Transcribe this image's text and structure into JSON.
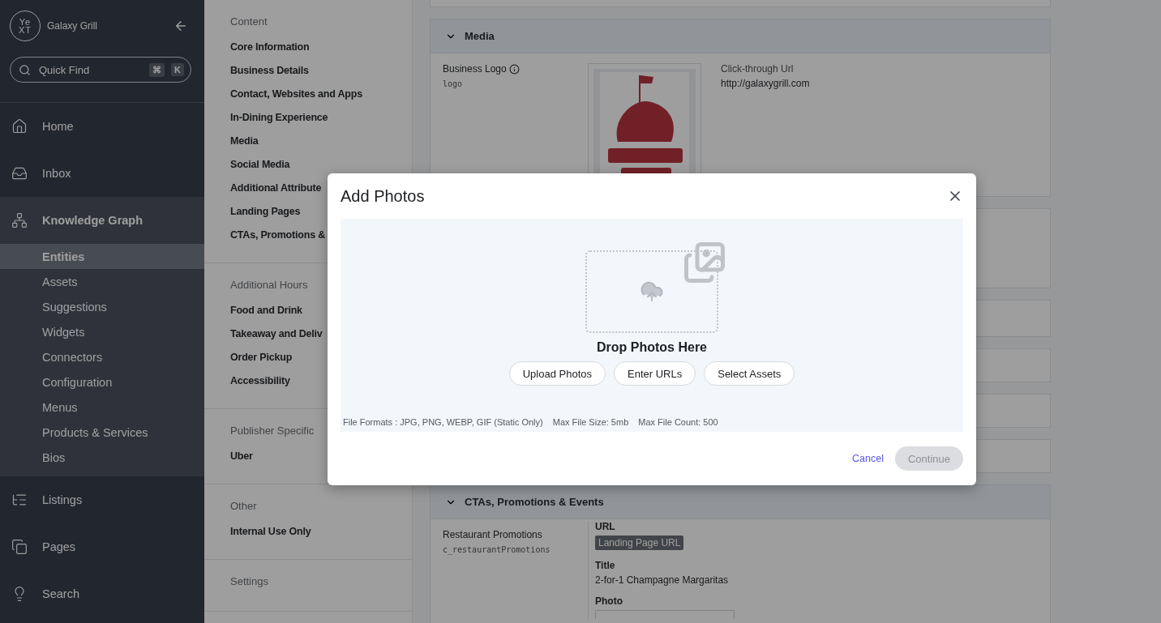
{
  "sidebar": {
    "logo": [
      "Ye",
      "XT"
    ],
    "account": "Galaxy Grill",
    "search": {
      "placeholder": "Quick Find",
      "keys": [
        "⌘",
        "K"
      ]
    },
    "items": [
      {
        "label": "Home",
        "selected": false
      },
      {
        "label": "Inbox",
        "selected": false
      },
      {
        "label": "Knowledge Graph",
        "selected": true,
        "expanded": true,
        "children": [
          {
            "label": "Entities",
            "selected": true
          },
          {
            "label": "Assets",
            "selected": false
          },
          {
            "label": "Suggestions",
            "selected": false
          },
          {
            "label": "Widgets",
            "selected": false
          },
          {
            "label": "Connectors",
            "selected": false
          },
          {
            "label": "Configuration",
            "selected": false
          },
          {
            "label": "Menus",
            "selected": false
          },
          {
            "label": "Products & Services",
            "selected": false
          },
          {
            "label": "Bios",
            "selected": false
          }
        ]
      },
      {
        "label": "Listings",
        "selected": false
      },
      {
        "label": "Pages",
        "selected": false
      },
      {
        "label": "Search",
        "selected": false
      }
    ]
  },
  "section_nav": [
    {
      "heading": "Content",
      "items": [
        "Core Information",
        "Business Details",
        "Contact, Websites and Apps",
        "In-Dining Experience",
        "Media",
        "Social Media",
        "Additional Attribute",
        "Landing Pages",
        "CTAs, Promotions &"
      ]
    },
    {
      "heading": "Additional Hours",
      "items": [
        "Food and Drink",
        "Takeaway and Deliv",
        "Order Pickup",
        "Accessibility"
      ]
    },
    {
      "heading": "Publisher Specific",
      "items": [
        "Uber"
      ]
    },
    {
      "heading": "Other",
      "items": [
        "Internal Use Only"
      ]
    },
    {
      "heading": "Settings"
    }
  ],
  "sections": [
    {
      "kind": "edge"
    },
    {
      "kind": "media",
      "title": "Media",
      "expanded": true,
      "field": "Business Logo",
      "api_name": "logo",
      "url_label": "Click-through Url",
      "url": "http://galaxygrill.com"
    },
    {
      "kind": "blank"
    },
    {
      "kind": "blank"
    },
    {
      "kind": "blank"
    },
    {
      "kind": "blank"
    },
    {
      "kind": "blank"
    },
    {
      "kind": "ctas",
      "title": "CTAs, Promotions & Events",
      "expanded": true,
      "field": "Restaurant Promotions",
      "api_name": "c_restaurantPromotions",
      "url_label": "URL",
      "tag": "Landing Page URL",
      "title_label": "Title",
      "title_value": "2-for-1 Champagne Margaritas",
      "photo_label": "Photo"
    }
  ],
  "dialog": {
    "title": "Add Photos",
    "drop_text": "Drop Photos Here",
    "buttons": [
      "Upload Photos",
      "Enter URLs",
      "Select Assets"
    ],
    "info": [
      "File Formats : JPG, PNG, WEBP, GIF (Static Only)",
      "Max File Size: 5mb",
      "Max File Count: 500"
    ],
    "cancel": "Cancel",
    "continue": {
      "label": "Continue",
      "disabled": true
    }
  }
}
